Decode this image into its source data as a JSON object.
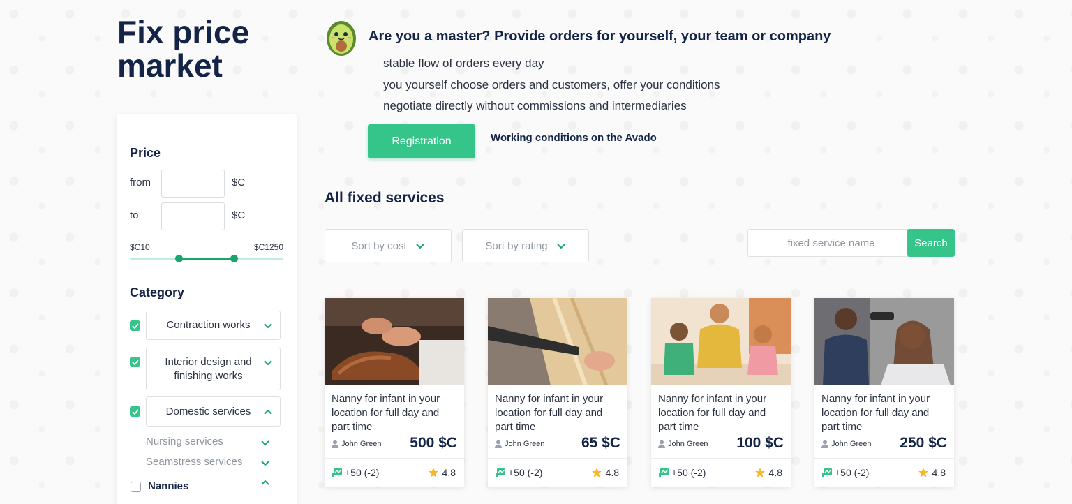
{
  "page": {
    "title": "Fix price market"
  },
  "hero": {
    "title": "Are you a master? Provide orders for yourself, your team or company",
    "benefits": [
      "stable flow of orders every day",
      "you yourself choose orders and customers, offer your conditions",
      "negotiate directly without commissions and intermediaries"
    ],
    "register_label": "Registration",
    "conditions_link": "Working conditions on the Avado"
  },
  "filters": {
    "price": {
      "heading": "Price",
      "from_label": "from",
      "to_label": "to",
      "currency": "$C",
      "from_value": "",
      "to_value": "",
      "range_min_label": "$C10",
      "range_max_label": "$C1250"
    },
    "category": {
      "heading": "Category",
      "items": [
        {
          "label": "Contraction works",
          "checked": true,
          "expanded": false
        },
        {
          "label": "Interior design and finishing works",
          "checked": true,
          "expanded": false
        },
        {
          "label": "Domestic services",
          "checked": true,
          "expanded": true
        }
      ],
      "subitems": [
        "Nursing services",
        "Seamstress services"
      ],
      "nannies_label": "Nannies"
    }
  },
  "main": {
    "section_title": "All fixed services",
    "sort": {
      "by_cost": "Sort by cost",
      "by_rating": "Sort by rating"
    },
    "search": {
      "placeholder": "fixed service name",
      "button": "Search"
    }
  },
  "cards": [
    {
      "title": "Nanny for infant in your location for full day and part time",
      "author": "John Green",
      "price": "500 $C",
      "reviews": "+50 (-2)",
      "rating": "4.8"
    },
    {
      "title": "Nanny for infant in your location for full day and part time",
      "author": "John Green",
      "price": "65 $C",
      "reviews": "+50 (-2)",
      "rating": "4.8"
    },
    {
      "title": "Nanny for infant in your location for full day and part time",
      "author": "John Green",
      "price": "100 $C",
      "reviews": "+50 (-2)",
      "rating": "4.8"
    },
    {
      "title": "Nanny for infant in your location for full day and part time",
      "author": "John Green",
      "price": "250 $C",
      "reviews": "+50 (-2)",
      "rating": "4.8"
    }
  ],
  "colors": {
    "accent": "#35c489",
    "accent_dark": "#18a66d",
    "heading": "#142446",
    "star": "#f5b82e"
  },
  "icons": [
    "avocado-mascot-icon",
    "chevron-down-icon",
    "chevron-up-icon",
    "check-icon",
    "user-icon",
    "reviews-icon",
    "star-icon"
  ]
}
